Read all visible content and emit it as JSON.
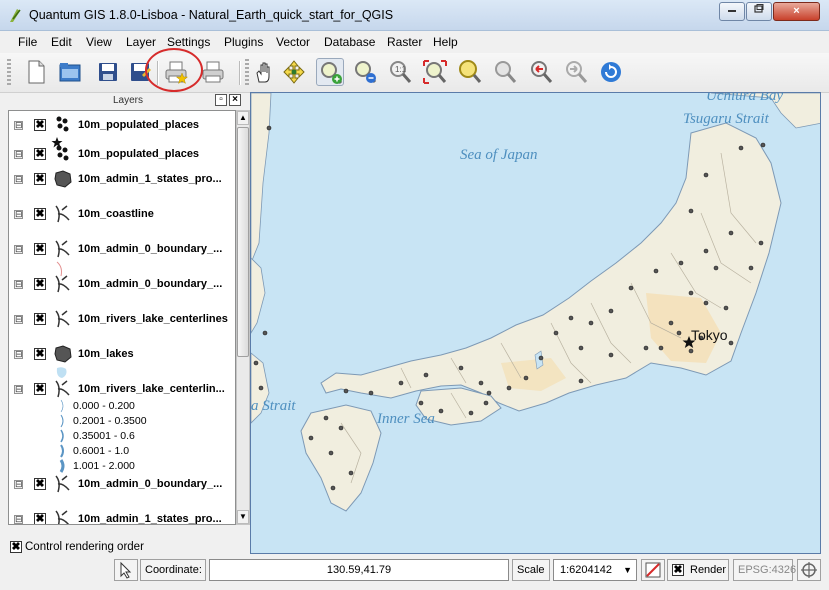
{
  "window": {
    "title": "Quantum GIS 1.8.0-Lisboa - Natural_Earth_quick_start_for_QGIS",
    "minimize": "0",
    "maximize": "1",
    "close": "×"
  },
  "menu": [
    "File",
    "Edit",
    "View",
    "Layer",
    "Settings",
    "Plugins",
    "Vector",
    "Database",
    "Raster",
    "Help"
  ],
  "toolbar": {
    "icons": [
      "new-project-icon",
      "open-project-icon",
      "save-project-icon",
      "save-as-icon",
      "new-print-composer-icon",
      "print-composer-manager-icon",
      "pan-icon",
      "pan-to-selection-icon",
      "zoom-in-icon",
      "zoom-out-icon",
      "zoom-actual-size-icon",
      "zoom-full-icon",
      "zoom-to-layer-icon",
      "zoom-to-selection-icon",
      "zoom-last-icon",
      "zoom-next-icon",
      "refresh-icon"
    ]
  },
  "layers_panel": {
    "title": "Layers",
    "float_button": "▫",
    "close_button": "×",
    "items": [
      {
        "name": "10m_populated_places",
        "icon": "points-icon"
      },
      {
        "name": "10m_populated_places",
        "icon": "points-icon"
      },
      {
        "name": "10m_admin_1_states_pro...",
        "icon": "polygon-icon"
      },
      {
        "name": "10m_coastline",
        "icon": "line-icon"
      },
      {
        "name": "10m_admin_0_boundary_...",
        "icon": "line-icon"
      },
      {
        "name": "10m_admin_0_boundary_...",
        "icon": "line-icon"
      },
      {
        "name": "10m_rivers_lake_centerlines",
        "icon": "line-icon"
      },
      {
        "name": "10m_lakes",
        "icon": "polygon-icon"
      },
      {
        "name": "10m_rivers_lake_centerlin...",
        "icon": "line-icon"
      },
      {
        "name": "10m_admin_0_boundary_...",
        "icon": "line-icon"
      },
      {
        "name": "10m_admin_1_states_pro...",
        "icon": "line-icon"
      }
    ],
    "ranges": [
      "0.000 - 0.200",
      "0.2001 - 0.3500",
      "0.35001 - 0.6",
      "0.6001 - 1.0",
      "1.001 - 2.000"
    ],
    "checkmark": "✖",
    "expander": "⊟",
    "control_rendering_order": "Control rendering order"
  },
  "map": {
    "labels": {
      "sea_of_japan": "Sea of Japan",
      "tsugaru_strait": "Tsugaru Strait",
      "uchiura_bay": "Uchiura Bay",
      "inner_sea": "Inner Sea",
      "strait": "a Strait",
      "tokyo": "Tokyo"
    },
    "colors": {
      "sea": "#c8e4f4",
      "land": "#f1eedf",
      "label": "#4e8fbf"
    }
  },
  "statusbar": {
    "coordinate_label": "Coordinate:",
    "coordinate_value": "130.59,41.79",
    "scale_label": "Scale",
    "scale_value": "1:6204142",
    "render_label": "Render",
    "crs": "EPSG:4326"
  }
}
